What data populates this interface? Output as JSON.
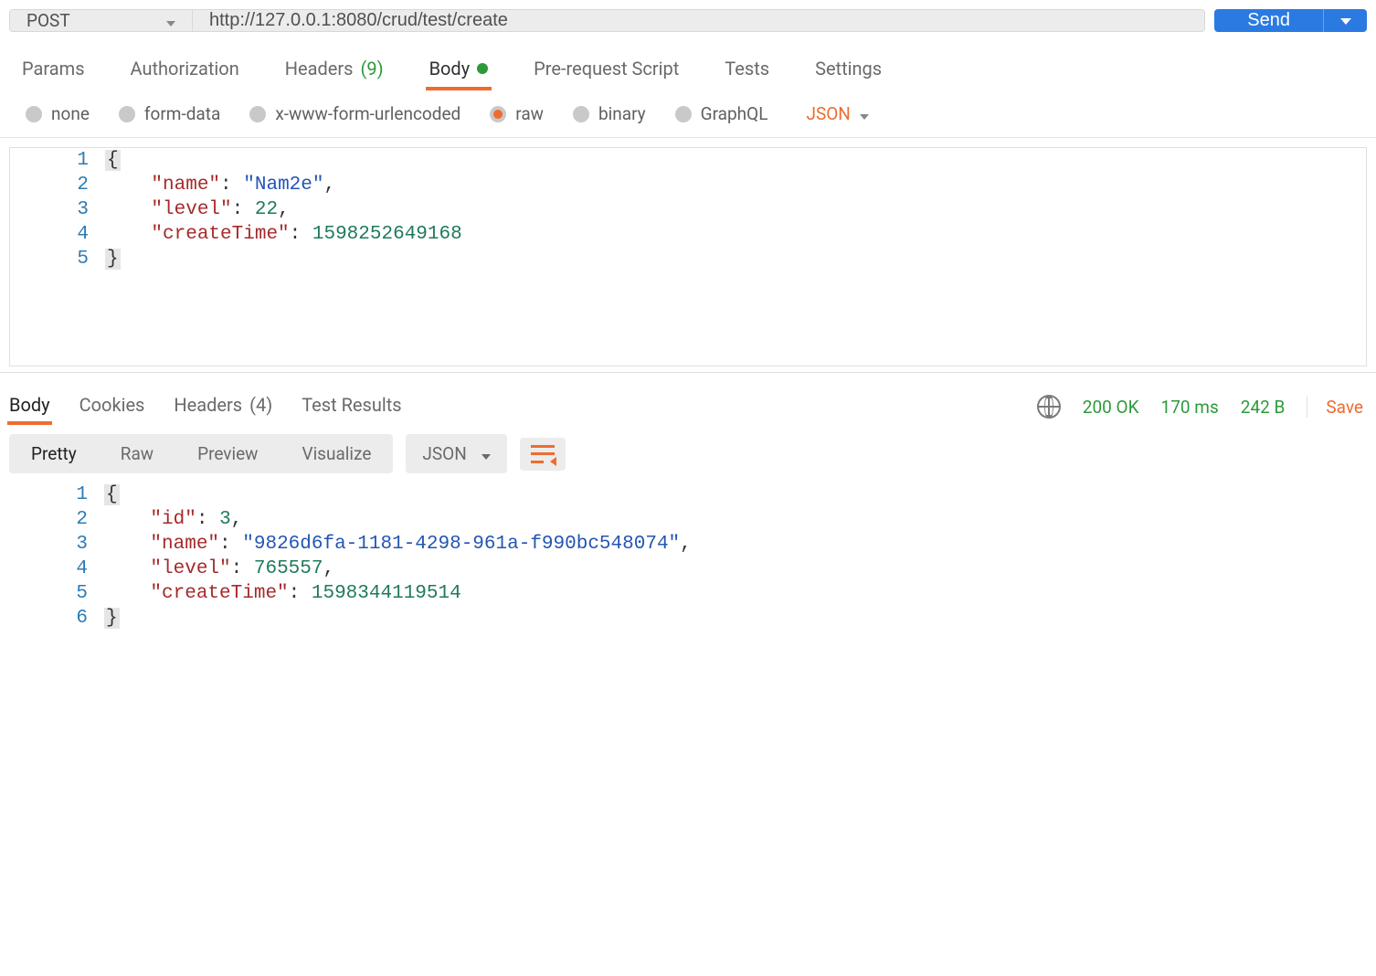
{
  "request": {
    "method": "POST",
    "url": "http://127.0.0.1:8080/crud/test/create",
    "send_label": "Send"
  },
  "request_tabs": {
    "params": "Params",
    "authorization": "Authorization",
    "headers_label": "Headers",
    "headers_count": "(9)",
    "body": "Body",
    "prerequest": "Pre-request Script",
    "tests": "Tests",
    "settings": "Settings"
  },
  "body_types": {
    "none": "none",
    "formdata": "form-data",
    "xwww": "x-www-form-urlencoded",
    "raw": "raw",
    "binary": "binary",
    "graphql": "GraphQL",
    "content_type": "JSON"
  },
  "request_body_lines": [
    "1",
    "2",
    "3",
    "4",
    "5"
  ],
  "request_body": {
    "name_key": "\"name\"",
    "name_val": "\"Nam2e\"",
    "level_key": "\"level\"",
    "level_val": "22",
    "createTime_key": "\"createTime\"",
    "createTime_val": "1598252649168"
  },
  "response_tabs": {
    "body": "Body",
    "cookies": "Cookies",
    "headers_label": "Headers",
    "headers_count": "(4)",
    "test_results": "Test Results"
  },
  "response_meta": {
    "status": "200 OK",
    "time": "170 ms",
    "size": "242 B",
    "save": "Save"
  },
  "response_toolbar": {
    "pretty": "Pretty",
    "raw": "Raw",
    "preview": "Preview",
    "visualize": "Visualize",
    "content_type": "JSON"
  },
  "response_body_lines": [
    "1",
    "2",
    "3",
    "4",
    "5",
    "6"
  ],
  "response_body": {
    "id_key": "\"id\"",
    "id_val": "3",
    "name_key": "\"name\"",
    "name_val": "\"9826d6fa-1181-4298-961a-f990bc548074\"",
    "level_key": "\"level\"",
    "level_val": "765557",
    "createTime_key": "\"createTime\"",
    "createTime_val": "1598344119514"
  }
}
